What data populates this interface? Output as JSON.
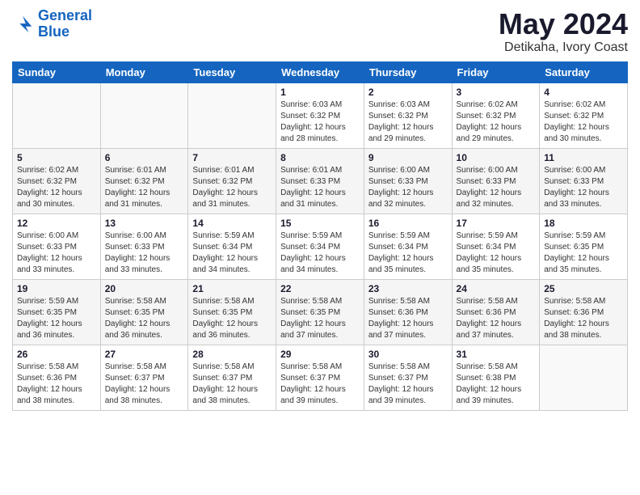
{
  "header": {
    "logo_line1": "General",
    "logo_line2": "Blue",
    "title": "May 2024",
    "subtitle": "Detikaha, Ivory Coast"
  },
  "days_of_week": [
    "Sunday",
    "Monday",
    "Tuesday",
    "Wednesday",
    "Thursday",
    "Friday",
    "Saturday"
  ],
  "weeks": [
    [
      {
        "num": "",
        "detail": ""
      },
      {
        "num": "",
        "detail": ""
      },
      {
        "num": "",
        "detail": ""
      },
      {
        "num": "1",
        "detail": "Sunrise: 6:03 AM\nSunset: 6:32 PM\nDaylight: 12 hours\nand 28 minutes."
      },
      {
        "num": "2",
        "detail": "Sunrise: 6:03 AM\nSunset: 6:32 PM\nDaylight: 12 hours\nand 29 minutes."
      },
      {
        "num": "3",
        "detail": "Sunrise: 6:02 AM\nSunset: 6:32 PM\nDaylight: 12 hours\nand 29 minutes."
      },
      {
        "num": "4",
        "detail": "Sunrise: 6:02 AM\nSunset: 6:32 PM\nDaylight: 12 hours\nand 30 minutes."
      }
    ],
    [
      {
        "num": "5",
        "detail": "Sunrise: 6:02 AM\nSunset: 6:32 PM\nDaylight: 12 hours\nand 30 minutes."
      },
      {
        "num": "6",
        "detail": "Sunrise: 6:01 AM\nSunset: 6:32 PM\nDaylight: 12 hours\nand 31 minutes."
      },
      {
        "num": "7",
        "detail": "Sunrise: 6:01 AM\nSunset: 6:32 PM\nDaylight: 12 hours\nand 31 minutes."
      },
      {
        "num": "8",
        "detail": "Sunrise: 6:01 AM\nSunset: 6:33 PM\nDaylight: 12 hours\nand 31 minutes."
      },
      {
        "num": "9",
        "detail": "Sunrise: 6:00 AM\nSunset: 6:33 PM\nDaylight: 12 hours\nand 32 minutes."
      },
      {
        "num": "10",
        "detail": "Sunrise: 6:00 AM\nSunset: 6:33 PM\nDaylight: 12 hours\nand 32 minutes."
      },
      {
        "num": "11",
        "detail": "Sunrise: 6:00 AM\nSunset: 6:33 PM\nDaylight: 12 hours\nand 33 minutes."
      }
    ],
    [
      {
        "num": "12",
        "detail": "Sunrise: 6:00 AM\nSunset: 6:33 PM\nDaylight: 12 hours\nand 33 minutes."
      },
      {
        "num": "13",
        "detail": "Sunrise: 6:00 AM\nSunset: 6:33 PM\nDaylight: 12 hours\nand 33 minutes."
      },
      {
        "num": "14",
        "detail": "Sunrise: 5:59 AM\nSunset: 6:34 PM\nDaylight: 12 hours\nand 34 minutes."
      },
      {
        "num": "15",
        "detail": "Sunrise: 5:59 AM\nSunset: 6:34 PM\nDaylight: 12 hours\nand 34 minutes."
      },
      {
        "num": "16",
        "detail": "Sunrise: 5:59 AM\nSunset: 6:34 PM\nDaylight: 12 hours\nand 35 minutes."
      },
      {
        "num": "17",
        "detail": "Sunrise: 5:59 AM\nSunset: 6:34 PM\nDaylight: 12 hours\nand 35 minutes."
      },
      {
        "num": "18",
        "detail": "Sunrise: 5:59 AM\nSunset: 6:35 PM\nDaylight: 12 hours\nand 35 minutes."
      }
    ],
    [
      {
        "num": "19",
        "detail": "Sunrise: 5:59 AM\nSunset: 6:35 PM\nDaylight: 12 hours\nand 36 minutes."
      },
      {
        "num": "20",
        "detail": "Sunrise: 5:58 AM\nSunset: 6:35 PM\nDaylight: 12 hours\nand 36 minutes."
      },
      {
        "num": "21",
        "detail": "Sunrise: 5:58 AM\nSunset: 6:35 PM\nDaylight: 12 hours\nand 36 minutes."
      },
      {
        "num": "22",
        "detail": "Sunrise: 5:58 AM\nSunset: 6:35 PM\nDaylight: 12 hours\nand 37 minutes."
      },
      {
        "num": "23",
        "detail": "Sunrise: 5:58 AM\nSunset: 6:36 PM\nDaylight: 12 hours\nand 37 minutes."
      },
      {
        "num": "24",
        "detail": "Sunrise: 5:58 AM\nSunset: 6:36 PM\nDaylight: 12 hours\nand 37 minutes."
      },
      {
        "num": "25",
        "detail": "Sunrise: 5:58 AM\nSunset: 6:36 PM\nDaylight: 12 hours\nand 38 minutes."
      }
    ],
    [
      {
        "num": "26",
        "detail": "Sunrise: 5:58 AM\nSunset: 6:36 PM\nDaylight: 12 hours\nand 38 minutes."
      },
      {
        "num": "27",
        "detail": "Sunrise: 5:58 AM\nSunset: 6:37 PM\nDaylight: 12 hours\nand 38 minutes."
      },
      {
        "num": "28",
        "detail": "Sunrise: 5:58 AM\nSunset: 6:37 PM\nDaylight: 12 hours\nand 38 minutes."
      },
      {
        "num": "29",
        "detail": "Sunrise: 5:58 AM\nSunset: 6:37 PM\nDaylight: 12 hours\nand 39 minutes."
      },
      {
        "num": "30",
        "detail": "Sunrise: 5:58 AM\nSunset: 6:37 PM\nDaylight: 12 hours\nand 39 minutes."
      },
      {
        "num": "31",
        "detail": "Sunrise: 5:58 AM\nSunset: 6:38 PM\nDaylight: 12 hours\nand 39 minutes."
      },
      {
        "num": "",
        "detail": ""
      }
    ]
  ]
}
